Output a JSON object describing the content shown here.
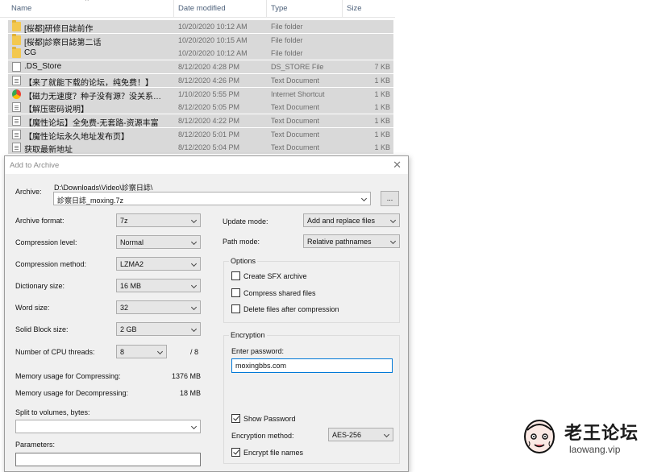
{
  "explorer": {
    "columns": {
      "name": "Name",
      "date": "Date modified",
      "type": "Type",
      "size": "Size"
    },
    "sort_indicator": "^",
    "rows": [
      {
        "icon": "folder-icon",
        "name": "[桜都]研修日誌前作",
        "date": "10/20/2020 10:12 AM",
        "type": "File folder",
        "size": ""
      },
      {
        "icon": "folder-icon",
        "name": "[桜都]診察日誌第二话",
        "date": "10/20/2020 10:15 AM",
        "type": "File folder",
        "size": ""
      },
      {
        "icon": "folder-icon",
        "name": "CG",
        "date": "10/20/2020 10:12 AM",
        "type": "File folder",
        "size": ""
      },
      {
        "icon": "file-icon",
        "name": ".DS_Store",
        "date": "8/12/2020 4:28 PM",
        "type": "DS_STORE File",
        "size": "7 KB"
      },
      {
        "icon": "text-doc-icon",
        "name": "【来了就能下载的论坛，纯免费！】",
        "date": "8/12/2020 4:26 PM",
        "type": "Text Document",
        "size": "1 KB"
      },
      {
        "icon": "internet-shortcut-icon",
        "name": "【磁力无速度？种子没有源？没关系…",
        "date": "1/10/2020 5:55 PM",
        "type": "Internet Shortcut",
        "size": "1 KB"
      },
      {
        "icon": "text-doc-icon",
        "name": "【解压密码说明】",
        "date": "8/12/2020 5:05 PM",
        "type": "Text Document",
        "size": "1 KB"
      },
      {
        "icon": "text-doc-icon",
        "name": "【魔性论坛】全免费-无套路-资源丰富",
        "date": "8/12/2020 4:22 PM",
        "type": "Text Document",
        "size": "1 KB"
      },
      {
        "icon": "text-doc-icon",
        "name": "【魔性论坛永久地址发布页】",
        "date": "8/12/2020 5:01 PM",
        "type": "Text Document",
        "size": "1 KB"
      },
      {
        "icon": "text-doc-icon",
        "name": "获取最新地址",
        "date": "8/12/2020 5:04 PM",
        "type": "Text Document",
        "size": "1 KB"
      }
    ]
  },
  "dialog": {
    "title": "Add to Archive",
    "archive_label": "Archive:",
    "archive_path": "D:\\Downloads\\Video\\診察日誌\\",
    "archive_name": "診察日誌_moxing.7z",
    "browse_label": "...",
    "left_fields": [
      {
        "key": "format",
        "label": "Archive format:",
        "value": "7z"
      },
      {
        "key": "level",
        "label": "Compression level:",
        "value": "Normal"
      },
      {
        "key": "method",
        "label": "Compression method:",
        "value": "LZMA2"
      },
      {
        "key": "dict",
        "label": "Dictionary size:",
        "value": "16 MB"
      },
      {
        "key": "word",
        "label": "Word size:",
        "value": "32"
      },
      {
        "key": "block",
        "label": "Solid Block size:",
        "value": "2 GB"
      }
    ],
    "threads_label": "Number of CPU threads:",
    "threads_value": "8",
    "threads_max": "/ 8",
    "mem_compress_label": "Memory usage for Compressing:",
    "mem_compress_value": "1376 MB",
    "mem_decompress_label": "Memory usage for Decompressing:",
    "mem_decompress_value": "18 MB",
    "split_label": "Split to volumes, bytes:",
    "split_value": "",
    "params_label": "Parameters:",
    "params_value": "",
    "update_mode_label": "Update mode:",
    "update_mode_value": "Add and replace files",
    "path_mode_label": "Path mode:",
    "path_mode_value": "Relative pathnames",
    "options_title": "Options",
    "options": [
      {
        "label": "Create SFX archive",
        "checked": false
      },
      {
        "label": "Compress shared files",
        "checked": false
      },
      {
        "label": "Delete files after compression",
        "checked": false
      }
    ],
    "encryption_title": "Encryption",
    "password_label": "Enter password:",
    "password_value": "moxingbbs.com",
    "show_password_label": "Show Password",
    "show_password_checked": true,
    "enc_method_label": "Encryption method:",
    "enc_method_value": "AES-256",
    "encrypt_names_label": "Encrypt file names",
    "encrypt_names_checked": true
  },
  "watermark": {
    "brand": "老王论坛",
    "site": "laowang.vip"
  }
}
